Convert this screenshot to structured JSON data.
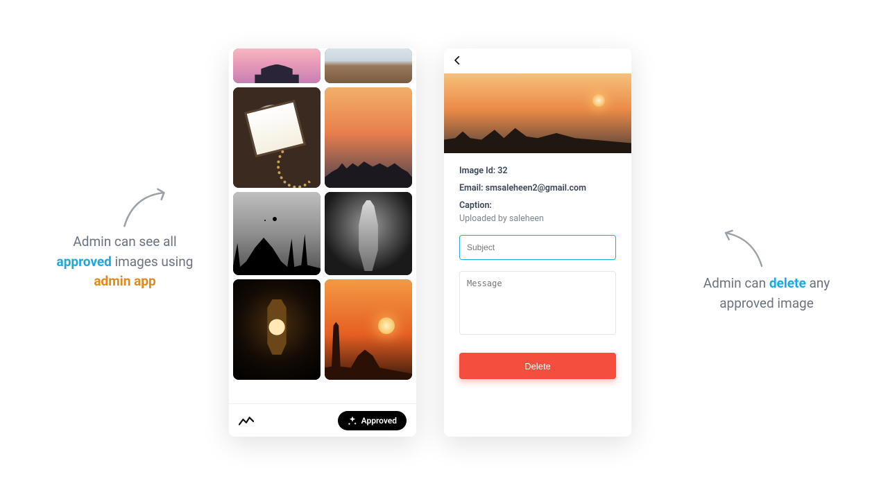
{
  "annotations": {
    "left": {
      "pre": "Admin can see all ",
      "hl1": "approved",
      "mid": " images using ",
      "hl2": "admin app"
    },
    "right": {
      "pre": "Admin can ",
      "hl1": "delete",
      "post": " any approved image"
    }
  },
  "left_phone": {
    "bottom_bar": {
      "approved_label": "Approved"
    }
  },
  "right_phone": {
    "image_id_key": "Image Id",
    "image_id_value": "32",
    "email_key": "Email",
    "email_value": "smsaleheen2@gmail.com",
    "caption_key": "Caption",
    "caption_value": "",
    "uploaded_by": "Uploaded by saleheen",
    "subject_placeholder": "Subject",
    "message_placeholder": "Message",
    "delete_label": "Delete"
  },
  "colors": {
    "accent_blue": "#1ba9e0",
    "accent_orange": "#e08a1b",
    "danger": "#f44e3f"
  }
}
